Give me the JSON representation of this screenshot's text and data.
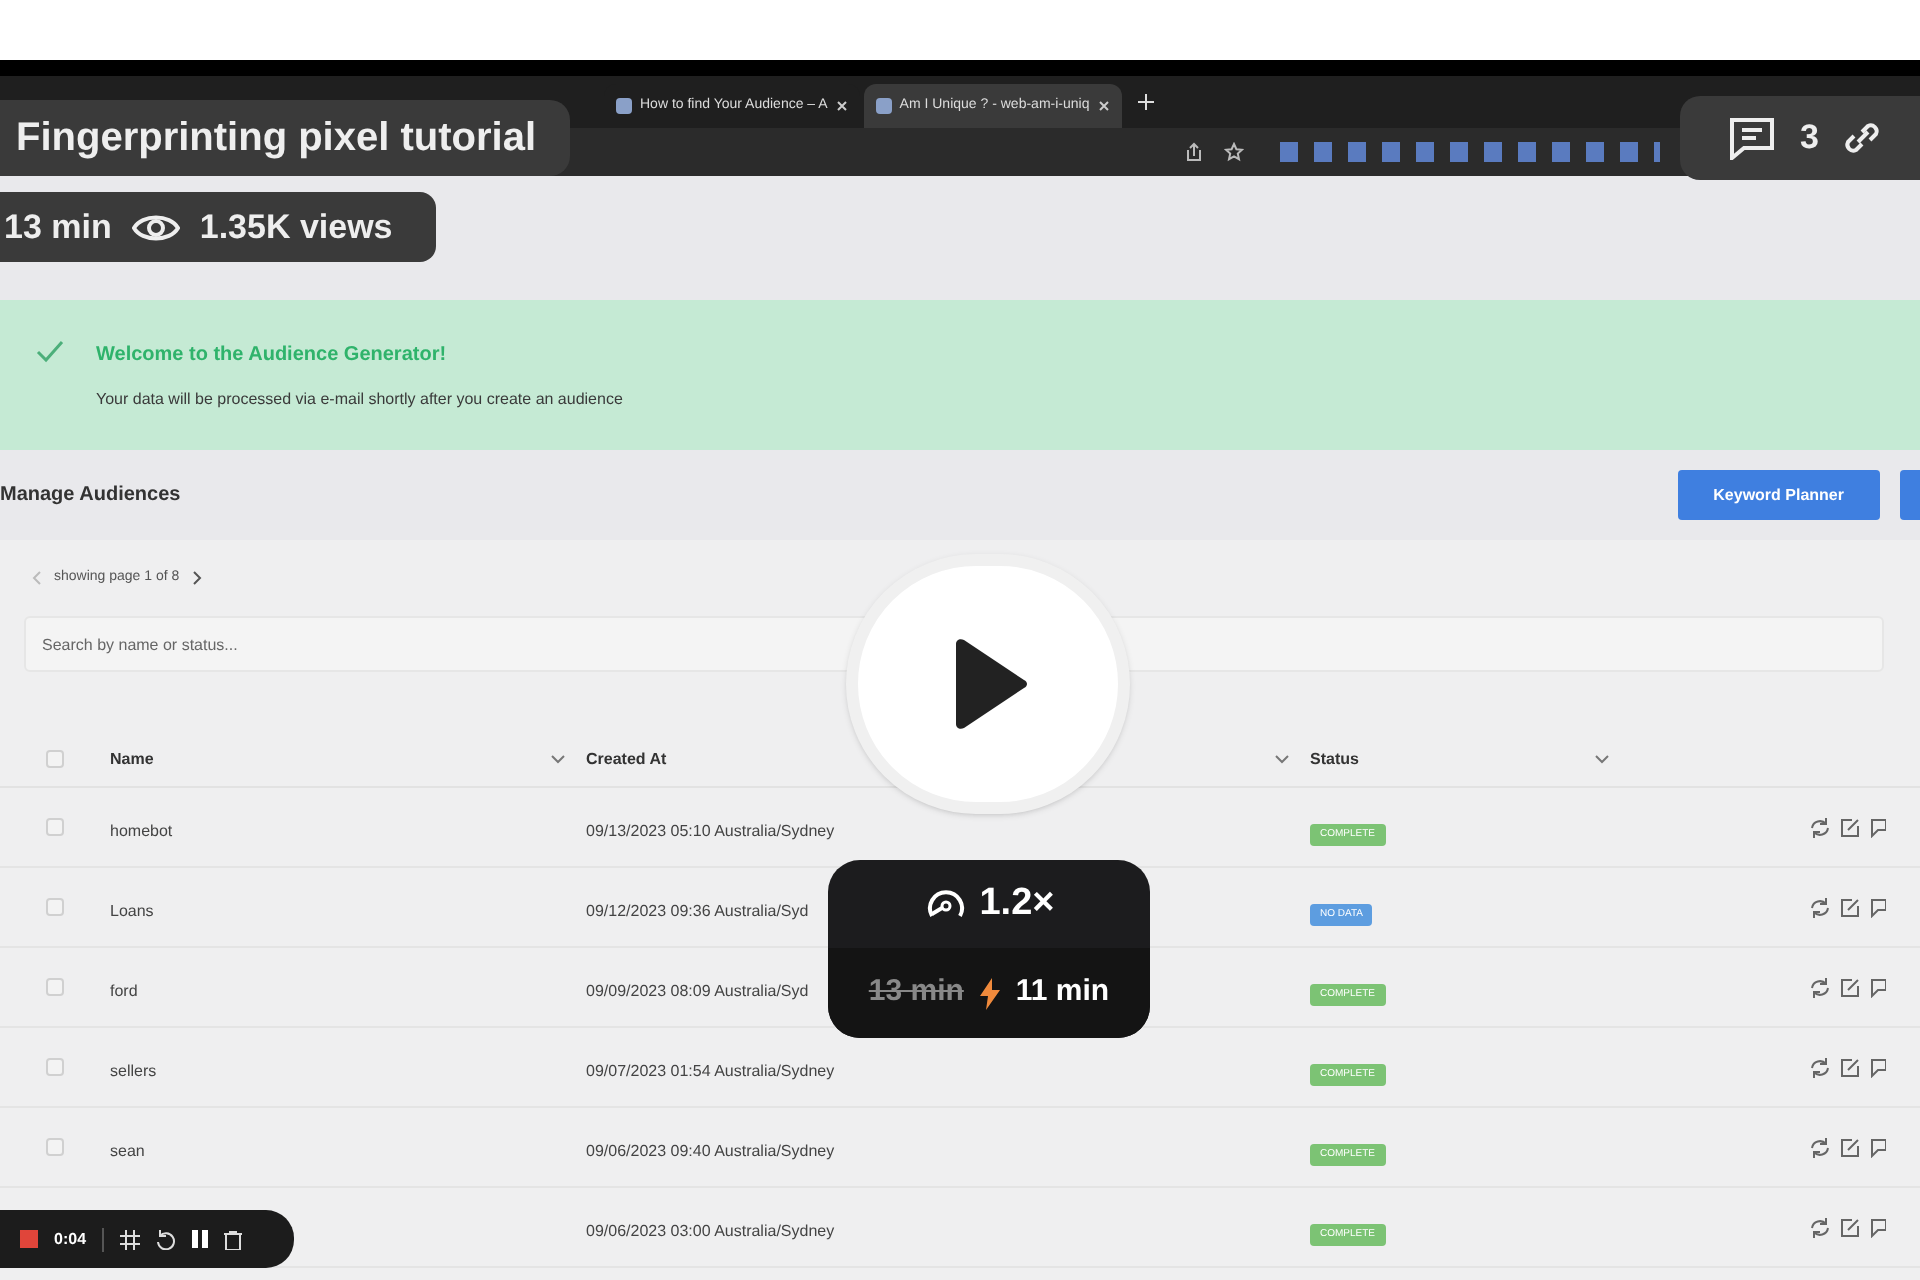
{
  "video": {
    "title": "Fingerprinting pixel tutorial",
    "duration": "13 min",
    "views": "1.35K views",
    "comments": "3"
  },
  "browser": {
    "tabs": [
      {
        "label": "How to find Your Audience – A",
        "selected": false
      },
      {
        "label": "Am I Unique ? - web-am-i-uniq",
        "selected": true
      }
    ]
  },
  "banner": {
    "title": "Welcome to the Audience Generator!",
    "message": "Your data will be processed via e-mail shortly after you create an audience"
  },
  "page": {
    "title": "Manage Audiences",
    "buttons": [
      "Keyword Planner"
    ],
    "pager": "showing page 1 of 8",
    "search": {
      "placeholder": "Search by name or status..."
    }
  },
  "table": {
    "columns": [
      "Name",
      "Created At",
      "Status"
    ],
    "header_checked": false,
    "rows": [
      {
        "name": "homebot",
        "created": "09/13/2023 05:10 Australia/Sydney",
        "status": "COMPLETE",
        "color": "#7cc374",
        "checked": false
      },
      {
        "name": "Loans",
        "created": "09/12/2023 09:36 Australia/Syd",
        "status": "NO DATA",
        "color": "#5d9de0",
        "checked": false
      },
      {
        "name": "ford",
        "created": "09/09/2023 08:09 Australia/Syd",
        "status": "COMPLETE",
        "color": "#7cc374",
        "checked": false
      },
      {
        "name": "sellers",
        "created": "09/07/2023 01:54 Australia/Sydney",
        "status": "COMPLETE",
        "color": "#7cc374",
        "checked": false
      },
      {
        "name": "sean",
        "created": "09/06/2023 09:40 Australia/Sydney",
        "status": "COMPLETE",
        "color": "#7cc374",
        "checked": false
      },
      {
        "created": "09/06/2023 03:00 Australia/Sydney",
        "status": "COMPLETE",
        "color": "#7cc374"
      }
    ]
  },
  "speed": {
    "rate": "1.2×",
    "original": "13 min",
    "reduced": "11 min"
  },
  "recorder": {
    "time": "0:04"
  }
}
